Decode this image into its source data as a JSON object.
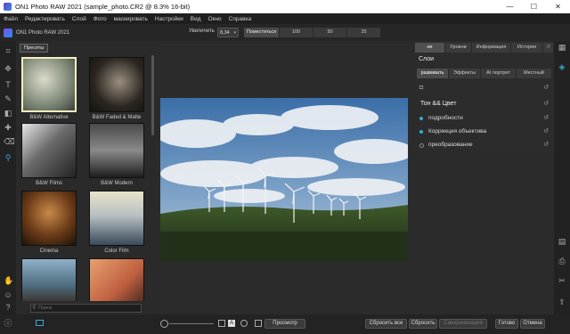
{
  "window": {
    "title": "ON1 Photo RAW 2021 (sample_photo.CR2 @ 8.3% 16-bit)",
    "minimize": "—",
    "maximize": "☐",
    "close": "✕"
  },
  "menu": [
    "Файл",
    "Редактировать",
    "Слой",
    "Фото",
    "маскировать",
    "Настройки",
    "Вид",
    "Окно",
    "Справка"
  ],
  "topbar": {
    "app_name": "ON1 Photo RAW 2021",
    "zoom_label": "Увеличить",
    "zoom_value": "8,34",
    "zoom_buttons": [
      "Поместиться",
      "100",
      "50",
      "25"
    ]
  },
  "presets": {
    "tab": "Пресеты",
    "items": [
      {
        "label": "B&W Alternative"
      },
      {
        "label": "B&W Faded & Matte"
      },
      {
        "label": "B&W Films"
      },
      {
        "label": "B&W Modern"
      },
      {
        "label": "Cinema"
      },
      {
        "label": "Color Film"
      }
    ],
    "search_placeholder": "Поиск"
  },
  "right_panel": {
    "top_tabs": [
      "не",
      "Уровни",
      "Информация",
      "История"
    ],
    "layers_title": "Слои",
    "module_tabs": [
      "развивать",
      "Эффекты",
      "AI портрет",
      "Местный"
    ],
    "group": "Тон && Цвет",
    "items": [
      {
        "label": "подробности",
        "active": true
      },
      {
        "label": "Коррекция объектива",
        "active": true
      },
      {
        "label": "преобразование",
        "active": false
      }
    ]
  },
  "bottom": {
    "preview": "Просмотр",
    "reset_all": "Сбросить все",
    "reset": "Сбросить",
    "sync": "Синхронизация",
    "done": "Готово",
    "cancel": "Отмена"
  },
  "colors": {
    "accent": "#3aa7d6",
    "selected_thumb": "#f2efc0"
  }
}
